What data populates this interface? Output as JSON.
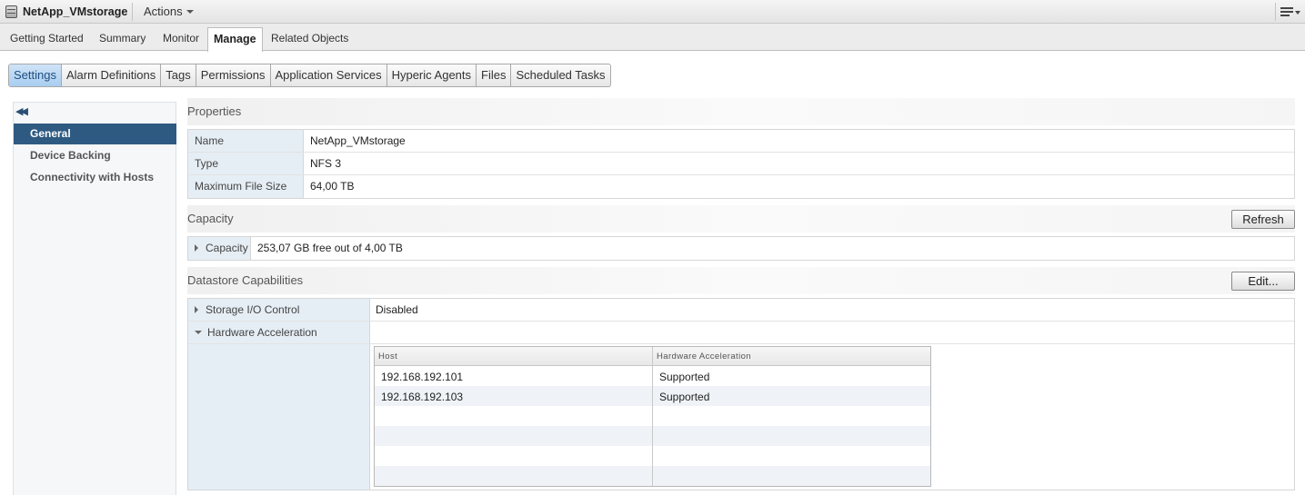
{
  "titlebar": {
    "title": "NetApp_VMstorage",
    "actions_label": "Actions"
  },
  "main_tabs": [
    {
      "label": "Getting Started"
    },
    {
      "label": "Summary"
    },
    {
      "label": "Monitor"
    },
    {
      "label": "Manage",
      "active": true
    },
    {
      "label": "Related Objects"
    }
  ],
  "sub_tabs": [
    {
      "label": "Settings",
      "active": true
    },
    {
      "label": "Alarm Definitions"
    },
    {
      "label": "Tags"
    },
    {
      "label": "Permissions"
    },
    {
      "label": "Application Services"
    },
    {
      "label": "Hyperic Agents"
    },
    {
      "label": "Files"
    },
    {
      "label": "Scheduled Tasks"
    }
  ],
  "nav": {
    "collapse_icon": "double-chevron-left-icon",
    "items": [
      {
        "label": "General",
        "active": true
      },
      {
        "label": "Device Backing"
      },
      {
        "label": "Connectivity with Hosts"
      }
    ]
  },
  "properties": {
    "heading": "Properties",
    "rows": [
      {
        "label": "Name",
        "value": "NetApp_VMstorage"
      },
      {
        "label": "Type",
        "value": "NFS 3"
      },
      {
        "label": "Maximum File Size",
        "value": "64,00 TB"
      }
    ]
  },
  "capacity": {
    "heading": "Capacity",
    "refresh_label": "Refresh",
    "row_label": "Capacity",
    "row_value": "253,07 GB free out of 4,00 TB"
  },
  "capabilities": {
    "heading": "Datastore Capabilities",
    "edit_label": "Edit...",
    "storage_io_label": "Storage I/O Control",
    "storage_io_value": "Disabled",
    "hw_accel_label": "Hardware Acceleration",
    "grid": {
      "columns": [
        "Host",
        "Hardware Acceleration"
      ],
      "rows": [
        [
          "192.168.192.101",
          "Supported"
        ],
        [
          "192.168.192.103",
          "Supported"
        ]
      ]
    }
  }
}
